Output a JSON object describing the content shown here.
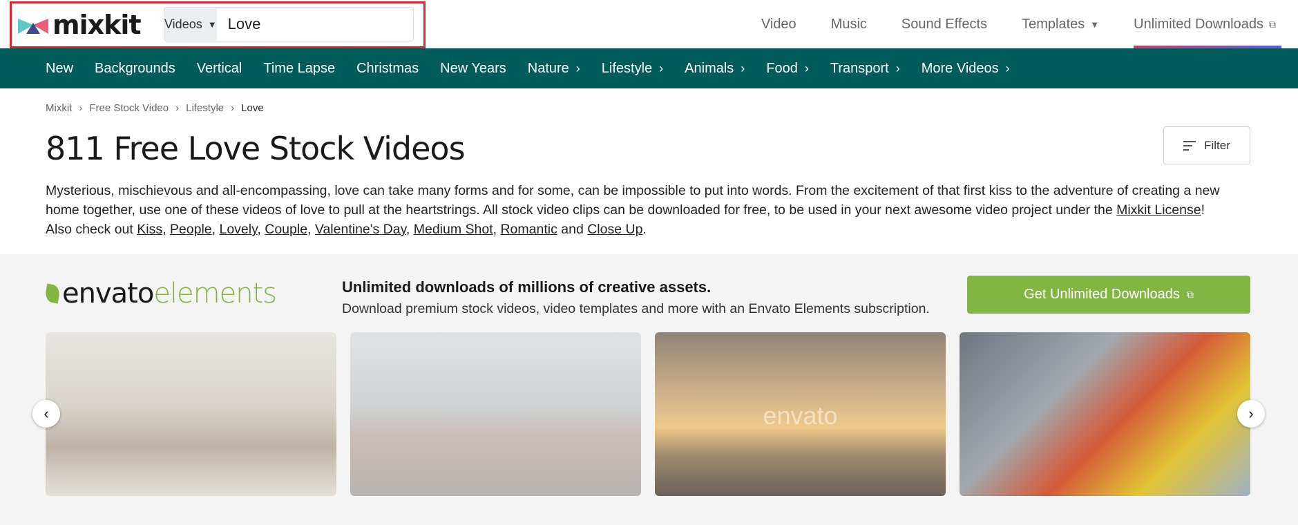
{
  "header": {
    "logo": "mixkit",
    "search": {
      "type": "Videos",
      "value": "Love",
      "clear": "×"
    },
    "nav": [
      "Video",
      "Music",
      "Sound Effects",
      "Templates",
      "Unlimited Downloads"
    ]
  },
  "subnav": [
    {
      "label": "New",
      "chevron": false
    },
    {
      "label": "Backgrounds",
      "chevron": false
    },
    {
      "label": "Vertical",
      "chevron": false
    },
    {
      "label": "Time Lapse",
      "chevron": false
    },
    {
      "label": "Christmas",
      "chevron": false
    },
    {
      "label": "New Years",
      "chevron": false
    },
    {
      "label": "Nature",
      "chevron": true
    },
    {
      "label": "Lifestyle",
      "chevron": true
    },
    {
      "label": "Animals",
      "chevron": true
    },
    {
      "label": "Food",
      "chevron": true
    },
    {
      "label": "Transport",
      "chevron": true
    },
    {
      "label": "More Videos",
      "chevron": true
    }
  ],
  "breadcrumb": [
    "Mixkit",
    "Free Stock Video",
    "Lifestyle",
    "Love"
  ],
  "title": "811 Free Love Stock Videos",
  "filter_label": "Filter",
  "description": {
    "text": "Mysterious, mischievous and all-encompassing, love can take many forms and for some, can be impossible to put into words. From the excitement of that first kiss to the adventure of creating a new home together, use one of these videos of love to pull at the heartstrings. All stock video clips can be downloaded for free, to be used in your next awesome video project under the ",
    "license_link": "Mixkit License",
    "also": "! Also check out ",
    "links": [
      "Kiss",
      "People",
      "Lovely",
      "Couple",
      "Valentine's Day",
      "Medium Shot",
      "Romantic"
    ],
    "and": " and ",
    "last_link": "Close Up",
    "end": "."
  },
  "promo": {
    "logo_a": "envato",
    "logo_b": "elements",
    "heading": "Unlimited downloads of millions of creative assets.",
    "sub": "Download premium stock videos, video templates and more with an Envato Elements subscription.",
    "cta": "Get Unlimited Downloads",
    "watermark": "envato"
  },
  "icons": {
    "prev": "‹",
    "next": "›",
    "caret": "▼",
    "chevron": "›",
    "external": "⧉"
  }
}
